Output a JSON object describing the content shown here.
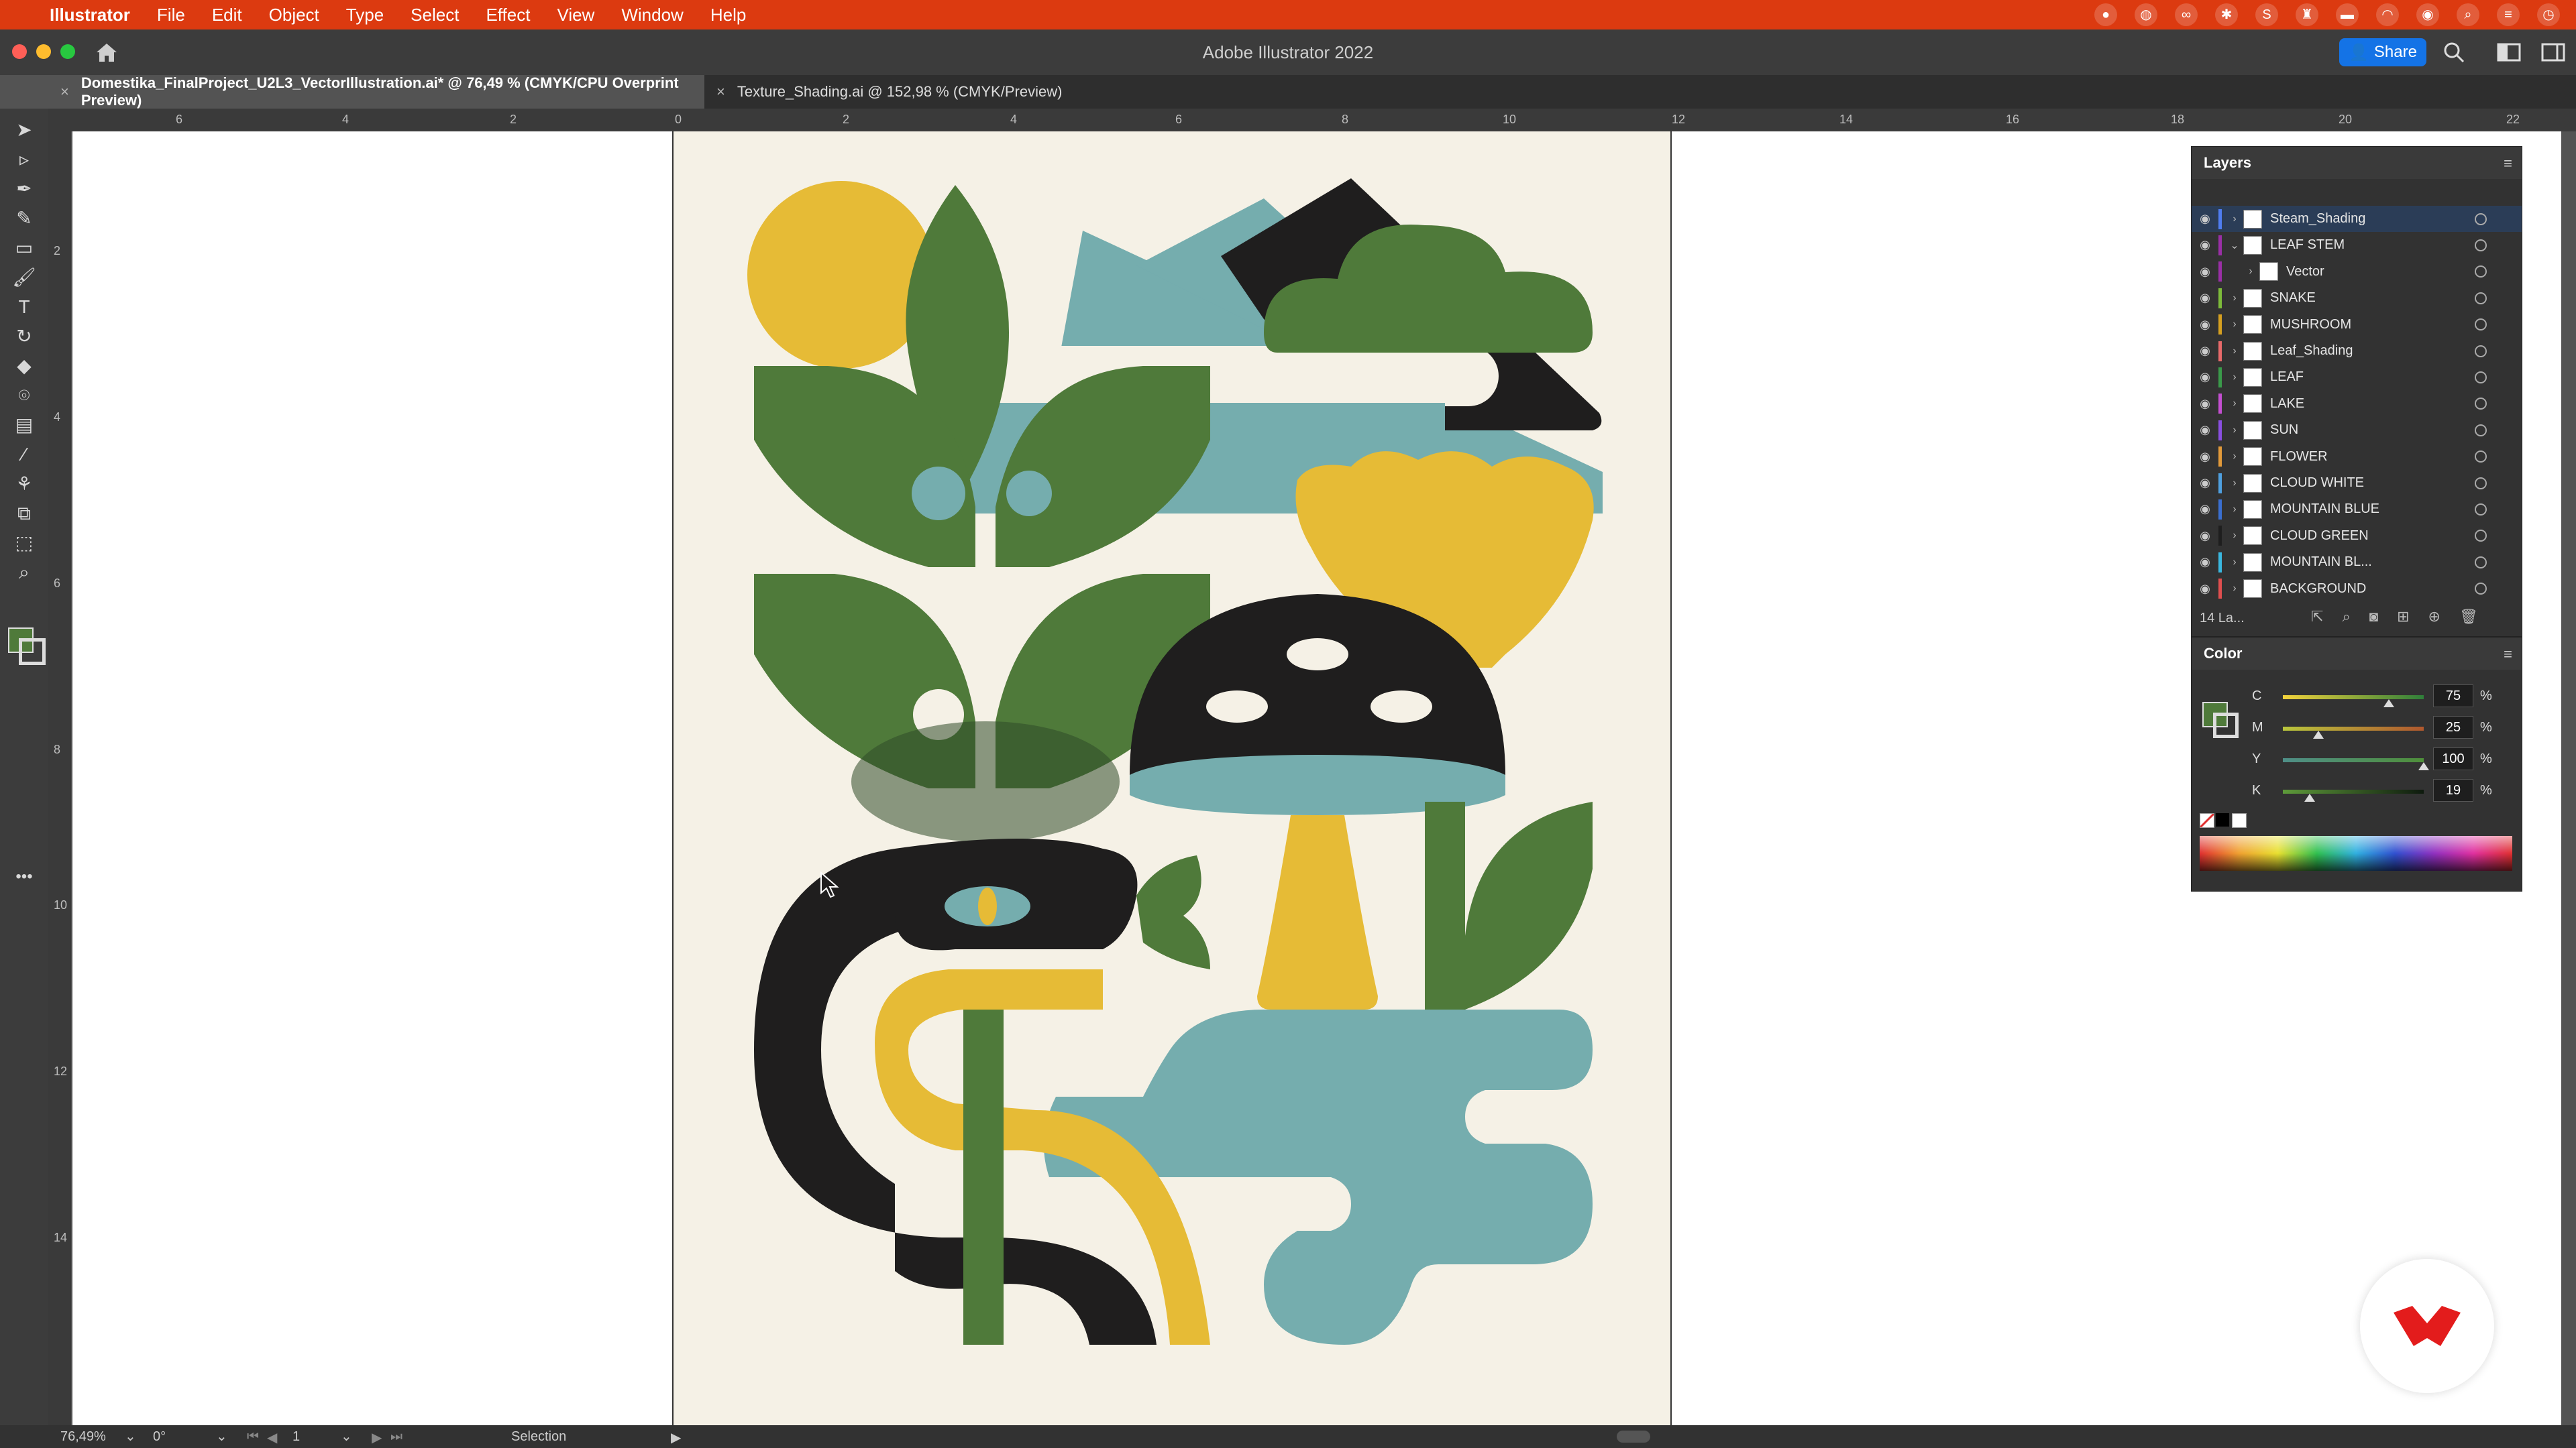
{
  "menubar": {
    "app_name": "Illustrator",
    "items": [
      "File",
      "Edit",
      "Object",
      "Type",
      "Select",
      "Effect",
      "View",
      "Window",
      "Help"
    ]
  },
  "titlebar": {
    "title": "Adobe Illustrator 2022",
    "share_label": "Share"
  },
  "tabs": [
    {
      "label": "Domestika_FinalProject_U2L3_VectorIllustration.ai* @ 76,49 % (CMYK/CPU Overprint Preview)",
      "active": true
    },
    {
      "label": "Texture_Shading.ai @ 152,98 % (CMYK/Preview)",
      "active": false
    }
  ],
  "ruler_top": [
    "6",
    "4",
    "2",
    "0",
    "2",
    "4",
    "6",
    "8",
    "10",
    "12",
    "14",
    "16",
    "18",
    "20",
    "22"
  ],
  "ruler_left": [
    "2",
    "4",
    "6",
    "8",
    "10",
    "12",
    "14"
  ],
  "layers": {
    "title": "Layers",
    "items": [
      {
        "name": "Steam_Shading",
        "color": "#4F7DF0",
        "expanded": false,
        "selected": true
      },
      {
        "name": "LEAF STEM",
        "color": "#9A2FA6",
        "expanded": true,
        "selected": false
      },
      {
        "name": "Vector",
        "color": "#9A2FA6",
        "expanded": false,
        "selected": false,
        "child": true
      },
      {
        "name": "SNAKE",
        "color": "#7DBB3A",
        "expanded": false,
        "selected": false
      },
      {
        "name": "MUSHROOM",
        "color": "#D6A020",
        "expanded": false,
        "selected": false
      },
      {
        "name": "Leaf_Shading",
        "color": "#E86A6A",
        "expanded": false,
        "selected": false
      },
      {
        "name": "LEAF",
        "color": "#3A9A4A",
        "expanded": false,
        "selected": false
      },
      {
        "name": "LAKE",
        "color": "#C44FD1",
        "expanded": false,
        "selected": false
      },
      {
        "name": "SUN",
        "color": "#8A4FE0",
        "expanded": false,
        "selected": false
      },
      {
        "name": "FLOWER",
        "color": "#E29A3A",
        "expanded": false,
        "selected": false
      },
      {
        "name": "CLOUD WHITE",
        "color": "#4FA0E0",
        "expanded": false,
        "selected": false
      },
      {
        "name": "MOUNTAIN BLUE",
        "color": "#3A6FD0",
        "expanded": false,
        "selected": false
      },
      {
        "name": "CLOUD GREEN",
        "color": "#1E1E1E",
        "expanded": false,
        "selected": false
      },
      {
        "name": "MOUNTAIN BL...",
        "color": "#3AB8E0",
        "expanded": false,
        "selected": false
      },
      {
        "name": "BACKGROUND",
        "color": "#E04F4F",
        "expanded": false,
        "selected": false
      }
    ],
    "footer_count": "14 La..."
  },
  "color_panel": {
    "title": "Color",
    "channels": [
      {
        "label": "C",
        "value": "75",
        "fraction": 0.75,
        "track": "linear-gradient(90deg,#F2D23B,#2F7F3A)"
      },
      {
        "label": "M",
        "value": "25",
        "fraction": 0.25,
        "track": "linear-gradient(90deg,#B9C63C,#B0582E)"
      },
      {
        "label": "Y",
        "value": "100",
        "fraction": 1.0,
        "track": "linear-gradient(90deg,#4F8F88,#4F8F3A)"
      },
      {
        "label": "K",
        "value": "19",
        "fraction": 0.19,
        "track": "linear-gradient(90deg,#5E9A3A,#0E1A0E)"
      }
    ],
    "percent_sign": "%",
    "fill_color": "#4F7A3A"
  },
  "statusbar": {
    "zoom": "76,49%",
    "rotation": "0°",
    "artboard_num": "1",
    "tool": "Selection"
  },
  "colors": {
    "cream": "#F5F1E6",
    "green": "#4F7A3A",
    "teal": "#75ADAE",
    "yellow": "#E6BB36",
    "black": "#1F1E1E",
    "menubar": "#DC3A10"
  }
}
